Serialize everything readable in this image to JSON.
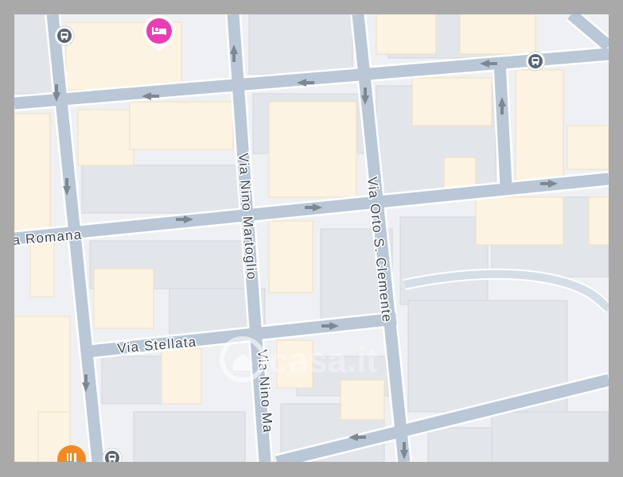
{
  "map": {
    "streets": [
      {
        "id": "via-romana",
        "label": "a Romana"
      },
      {
        "id": "via-nino-martoglio",
        "label": "Via Nino Martoglio"
      },
      {
        "id": "via-nino-martoglio-2",
        "label": "Via Nino Ma"
      },
      {
        "id": "via-orto-s-clemente",
        "label": "Via Orto S. Clemente"
      },
      {
        "id": "via-stellata",
        "label": "Via Stellata"
      }
    ],
    "watermark": "casa.it",
    "markers": [
      {
        "type": "hotel",
        "icon": "bed-icon",
        "color": "#e83eb4"
      },
      {
        "type": "restaurant",
        "icon": "fork-knife-icon",
        "color": "#f08a24"
      },
      {
        "type": "bus-stop",
        "icon": "bus-icon",
        "color": "#5b6673"
      }
    ],
    "colors": {
      "road": "#b9c7d6",
      "road_edge": "#ffffff",
      "block": "#e3e6eb",
      "building": "#d9dde3",
      "building_warm": "#fcf3e2",
      "arrow": "#7d8894"
    }
  }
}
